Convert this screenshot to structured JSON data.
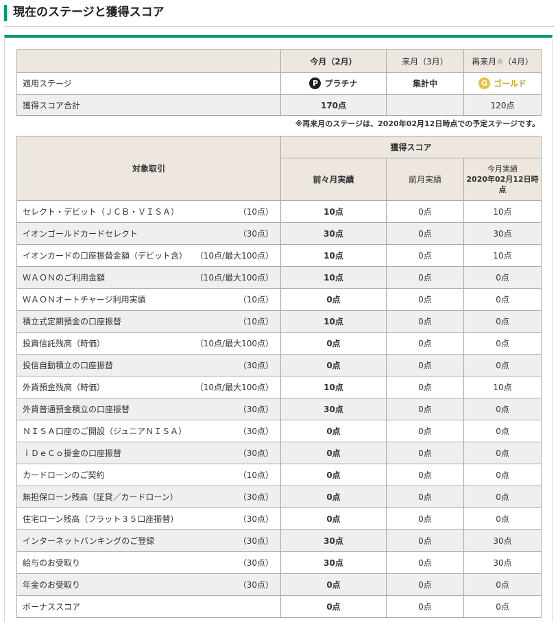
{
  "page": {
    "title": "現在のステージと獲得スコア"
  },
  "stage_table": {
    "cols": {
      "this_month": "今月（2月）",
      "next_month": "来月（3月）",
      "month_after": "再来月",
      "month_after_mark": "※",
      "month_after_paren": "（4月）"
    },
    "stage_row": {
      "label": "適用ステージ",
      "this_month": "プラチナ",
      "this_icon": "P",
      "next_month": "集計中",
      "month_after": "ゴールド",
      "after_icon": "G"
    },
    "score_row": {
      "label": "獲得スコア合計",
      "this_month": "170点",
      "next_month": "",
      "month_after": "120点"
    },
    "footnote": "※再来月のステージは、2020年02月12日時点での予定ステージです。"
  },
  "score_table": {
    "col_item": "対象取引",
    "col_group": "獲得スコア",
    "col_two_months_ago": "前々月実績",
    "col_last_month": "前月実績",
    "col_this_month_l1": "今月実績",
    "col_this_month_l2": "2020年02月12日時",
    "col_this_month_l3": "点",
    "rows": [
      {
        "name": "セレクト・デビット（ＪＣＢ・ＶＩＳＡ）",
        "points": "（10点）",
        "a": "10点",
        "b": "0点",
        "c": "10点"
      },
      {
        "name": "イオンゴールドカードセレクト",
        "points": "（30点）",
        "a": "30点",
        "b": "0点",
        "c": "30点"
      },
      {
        "name": "イオンカードの口座振替金額（デビット含）",
        "points": "（10点/最大100点）",
        "a": "10点",
        "b": "0点",
        "c": "10点"
      },
      {
        "name": "ＷＡＯＮのご利用金額",
        "points": "（10点/最大100点）",
        "a": "10点",
        "b": "0点",
        "c": "0点"
      },
      {
        "name": "ＷＡＯＮオートチャージ利用実績",
        "points": "（10点）",
        "a": "0点",
        "b": "0点",
        "c": "0点"
      },
      {
        "name": "積立式定期預金の口座振替",
        "points": "（10点）",
        "a": "10点",
        "b": "0点",
        "c": "0点"
      },
      {
        "name": "投資信託残高（時価）",
        "points": "（10点/最大100点）",
        "a": "0点",
        "b": "0点",
        "c": "0点"
      },
      {
        "name": "投信自動積立の口座振替",
        "points": "（30点）",
        "a": "0点",
        "b": "0点",
        "c": "0点"
      },
      {
        "name": "外貨預金残高（時価）",
        "points": "（10点/最大100点）",
        "a": "10点",
        "b": "0点",
        "c": "10点"
      },
      {
        "name": "外貨普通預金積立の口座振替",
        "points": "（30点）",
        "a": "30点",
        "b": "0点",
        "c": "0点"
      },
      {
        "name": "ＮＩＳＡ口座のご開設（ジュニアＮＩＳＡ）",
        "points": "（30点）",
        "a": "0点",
        "b": "0点",
        "c": "0点"
      },
      {
        "name": "ｉＤｅＣｏ掛金の口座振替",
        "points": "（30点）",
        "a": "0点",
        "b": "0点",
        "c": "0点"
      },
      {
        "name": "カードローンのご契約",
        "points": "（10点）",
        "a": "0点",
        "b": "0点",
        "c": "0点"
      },
      {
        "name": "無担保ローン残高（証貸／カードローン）",
        "points": "（30点）",
        "a": "0点",
        "b": "0点",
        "c": "0点"
      },
      {
        "name": "住宅ローン残高（フラット３５口座振替）",
        "points": "（30点）",
        "a": "0点",
        "b": "0点",
        "c": "0点"
      },
      {
        "name": "インターネットバンキングのご登録",
        "points": "（30点）",
        "a": "30点",
        "b": "0点",
        "c": "30点"
      },
      {
        "name": "給与のお受取り",
        "points": "（30点）",
        "a": "30点",
        "b": "0点",
        "c": "30点"
      },
      {
        "name": "年金のお受取り",
        "points": "（30点）",
        "a": "0点",
        "b": "0点",
        "c": "0点"
      },
      {
        "name": "ボーナススコア",
        "points": "",
        "a": "0点",
        "b": "0点",
        "c": "0点"
      }
    ]
  }
}
